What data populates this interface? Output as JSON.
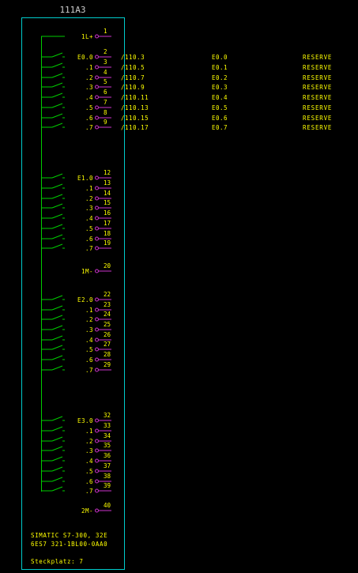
{
  "module": {
    "title": "111A3",
    "footer_line1": "SIMATIC S7-300, 32E",
    "footer_line2": "6ES7 321-1BL00-0AA0",
    "slot_label": "Steckplatz: 7"
  },
  "colors": {
    "background": "#000000",
    "border": "#00cccc",
    "wiring": "#00cc00",
    "text": "#ffff00",
    "terminal": "#cc33cc"
  },
  "rows": [
    {
      "label": "1L+",
      "terminal": "1",
      "kind": "supply"
    },
    {
      "label": "E0.0",
      "terminal": "2",
      "kind": "input",
      "xref": "/110.3",
      "addr": "E0.0",
      "comment": "RESERVE"
    },
    {
      "label": ".1",
      "terminal": "3",
      "kind": "input",
      "xref": "/110.5",
      "addr": "E0.1",
      "comment": "RESERVE"
    },
    {
      "label": ".2",
      "terminal": "4",
      "kind": "input",
      "xref": "/110.7",
      "addr": "E0.2",
      "comment": "RESERVE"
    },
    {
      "label": ".3",
      "terminal": "5",
      "kind": "input",
      "xref": "/110.9",
      "addr": "E0.3",
      "comment": "RESERVE"
    },
    {
      "label": ".4",
      "terminal": "6",
      "kind": "input",
      "xref": "/110.11",
      "addr": "E0.4",
      "comment": "RESERVE"
    },
    {
      "label": ".5",
      "terminal": "7",
      "kind": "input",
      "xref": "/110.13",
      "addr": "E0.5",
      "comment": "RESERVE"
    },
    {
      "label": ".6",
      "terminal": "8",
      "kind": "input",
      "xref": "/110.15",
      "addr": "E0.6",
      "comment": "RESERVE"
    },
    {
      "label": ".7",
      "terminal": "9",
      "kind": "input",
      "xref": "/110.17",
      "addr": "E0.7",
      "comment": "RESERVE"
    },
    {
      "label": "E1.0",
      "terminal": "12",
      "kind": "input"
    },
    {
      "label": ".1",
      "terminal": "13",
      "kind": "input"
    },
    {
      "label": ".2",
      "terminal": "14",
      "kind": "input"
    },
    {
      "label": ".3",
      "terminal": "15",
      "kind": "input"
    },
    {
      "label": ".4",
      "terminal": "16",
      "kind": "input"
    },
    {
      "label": ".5",
      "terminal": "17",
      "kind": "input"
    },
    {
      "label": ".6",
      "terminal": "18",
      "kind": "input"
    },
    {
      "label": ".7",
      "terminal": "19",
      "kind": "input"
    },
    {
      "label": "1M-",
      "terminal": "20",
      "kind": "ground"
    },
    {
      "label": "E2.0",
      "terminal": "22",
      "kind": "input"
    },
    {
      "label": ".1",
      "terminal": "23",
      "kind": "input"
    },
    {
      "label": ".2",
      "terminal": "24",
      "kind": "input"
    },
    {
      "label": ".3",
      "terminal": "25",
      "kind": "input"
    },
    {
      "label": ".4",
      "terminal": "26",
      "kind": "input"
    },
    {
      "label": ".5",
      "terminal": "27",
      "kind": "input"
    },
    {
      "label": ".6",
      "terminal": "28",
      "kind": "input"
    },
    {
      "label": ".7",
      "terminal": "29",
      "kind": "input"
    },
    {
      "label": "E3.0",
      "terminal": "32",
      "kind": "input"
    },
    {
      "label": ".1",
      "terminal": "33",
      "kind": "input"
    },
    {
      "label": ".2",
      "terminal": "34",
      "kind": "input"
    },
    {
      "label": ".3",
      "terminal": "35",
      "kind": "input"
    },
    {
      "label": ".4",
      "terminal": "36",
      "kind": "input"
    },
    {
      "label": ".5",
      "terminal": "37",
      "kind": "input"
    },
    {
      "label": ".6",
      "terminal": "38",
      "kind": "input"
    },
    {
      "label": ".7",
      "terminal": "39",
      "kind": "input"
    },
    {
      "label": "2M-",
      "terminal": "40",
      "kind": "ground"
    }
  ]
}
